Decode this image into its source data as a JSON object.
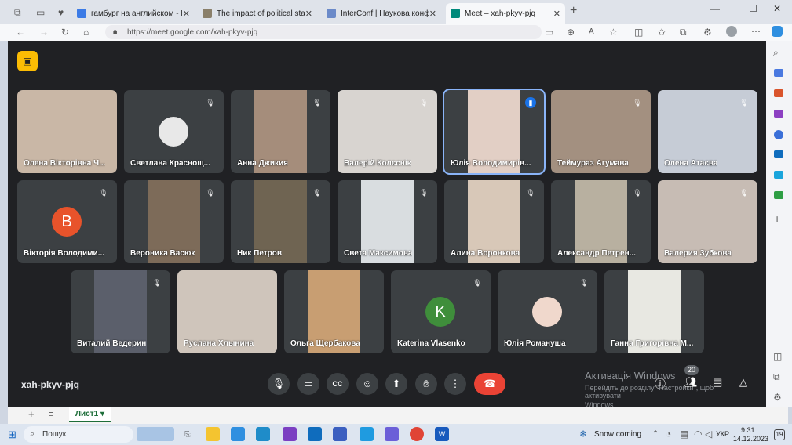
{
  "browser": {
    "tabs": [
      {
        "label": "гамбург на английском - Поиск",
        "color": "#3c7be6"
      },
      {
        "label": "The impact of political stability o",
        "color": "#8a7f6a"
      },
      {
        "label": "InterConf | Наукова конференц",
        "color": "#6b8ac9"
      },
      {
        "label": "Meet – xah-pkyv-pjq",
        "color": "#00897b"
      }
    ],
    "url": "https://meet.google.com/xah-pkyv-pjq"
  },
  "meet": {
    "meeting_code": "xah-pkyv-pjq",
    "people_count": "20",
    "participants": [
      {
        "name": "Олена Вікторівна Ч...",
        "cam": "#c9b7a6",
        "av": "",
        "avc": "",
        "muted": false
      },
      {
        "name": "Светлана Краснощ...",
        "cam": "",
        "av": "",
        "avc": "#e8e8e8",
        "muted": true
      },
      {
        "name": "Анна Джикия",
        "cam": "#a58d7b",
        "av": "",
        "avc": "",
        "muted": true
      },
      {
        "name": "Валерій Колєснік",
        "cam": "#d8d4d0",
        "av": "",
        "avc": "",
        "muted": true
      },
      {
        "name": "Юлія Володимирів...",
        "cam": "#e2cfc5",
        "av": "",
        "avc": "",
        "muted": false
      },
      {
        "name": "Теймураз Агумава",
        "cam": "#a39080",
        "av": "",
        "avc": "",
        "muted": true
      },
      {
        "name": "Олена Атаєва",
        "cam": "#c6ccd6",
        "av": "",
        "avc": "",
        "muted": true
      },
      {
        "name": "Вікторія Володими...",
        "cam": "",
        "av": "B",
        "avc": "#e8532b",
        "muted": true
      },
      {
        "name": "Вероника Васюк",
        "cam": "#7d6b59",
        "av": "",
        "avc": "",
        "muted": true
      },
      {
        "name": "Ник Петров",
        "cam": "#6f6452",
        "av": "",
        "avc": "",
        "muted": true
      },
      {
        "name": "Света Максимова",
        "cam": "#d9dde0",
        "av": "",
        "avc": "",
        "muted": true
      },
      {
        "name": "Алина Воронкова",
        "cam": "#d8c8b8",
        "av": "",
        "avc": "",
        "muted": true
      },
      {
        "name": "Александр Петрен...",
        "cam": "#b8b0a0",
        "av": "",
        "avc": "",
        "muted": true
      },
      {
        "name": "Валерия Зубкова",
        "cam": "#c7bcb4",
        "av": "",
        "avc": "",
        "muted": true
      },
      {
        "name": "Виталий Ведерин",
        "cam": "#5b5f6b",
        "av": "",
        "avc": "",
        "muted": true
      },
      {
        "name": "Руслана Хлынина",
        "cam": "#cfc5bb",
        "av": "",
        "avc": "",
        "muted": false
      },
      {
        "name": "Ольга Щербакова",
        "cam": "#c89e72",
        "av": "",
        "avc": "",
        "muted": false
      },
      {
        "name": "Katerina Vlasenko",
        "cam": "",
        "av": "K",
        "avc": "#3f8e3b",
        "muted": true
      },
      {
        "name": "Юлія Романуша",
        "cam": "",
        "av": "",
        "avc": "#f0d8cc",
        "muted": true
      },
      {
        "name": "Ганна Григорівна М...",
        "cam": "#e8e8e2",
        "av": "",
        "avc": "",
        "muted": false
      }
    ]
  },
  "watermark": {
    "title": "Активація Windows",
    "line1": "Перейдіть до розділу \"Настройки\", щоб активувати",
    "line2": "Windows."
  },
  "sheet": {
    "tab": "Лист1"
  },
  "taskbar": {
    "search": "Пошук",
    "weather": "Snow coming",
    "lang": "УКР",
    "time": "9:31",
    "date": "14.12.2023",
    "badge": "19"
  }
}
